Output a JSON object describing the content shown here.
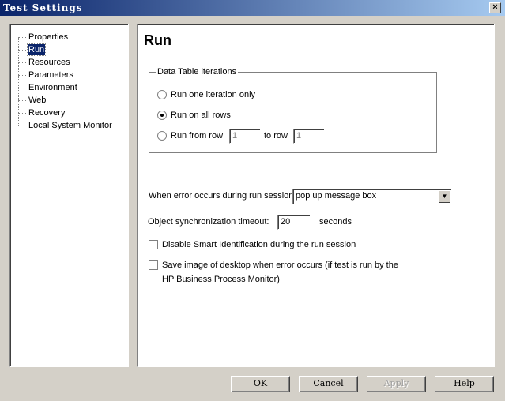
{
  "window": {
    "title": "Test Settings",
    "close_label": "×"
  },
  "tree": {
    "items": [
      "Properties",
      "Run",
      "Resources",
      "Parameters",
      "Environment",
      "Web",
      "Recovery",
      "Local System Monitor"
    ],
    "selected": "Run"
  },
  "panel": {
    "title": "Run",
    "group_label": "Data Table iterations",
    "radio_one": "Run one iteration only",
    "radio_all": "Run on all rows",
    "radio_range": "Run from row",
    "selected_radio": "Run on all rows",
    "from_row": "1",
    "to_row_label": "to row",
    "to_row": "1",
    "error_label": "When error occurs during run session:",
    "error_value": "pop up message box",
    "timeout_label": "Object synchronization timeout:",
    "timeout_value": "20",
    "timeout_unit": "seconds",
    "disable_smart_id": "Disable Smart Identification during the run session",
    "disable_smart_id_checked": false,
    "save_image_line1": "Save image of desktop when error occurs (if test is run by the",
    "save_image_line2": "HP Business Process Monitor)",
    "save_image_checked": false
  },
  "buttons": {
    "ok": "OK",
    "cancel": "Cancel",
    "apply": "Apply",
    "help": "Help"
  }
}
